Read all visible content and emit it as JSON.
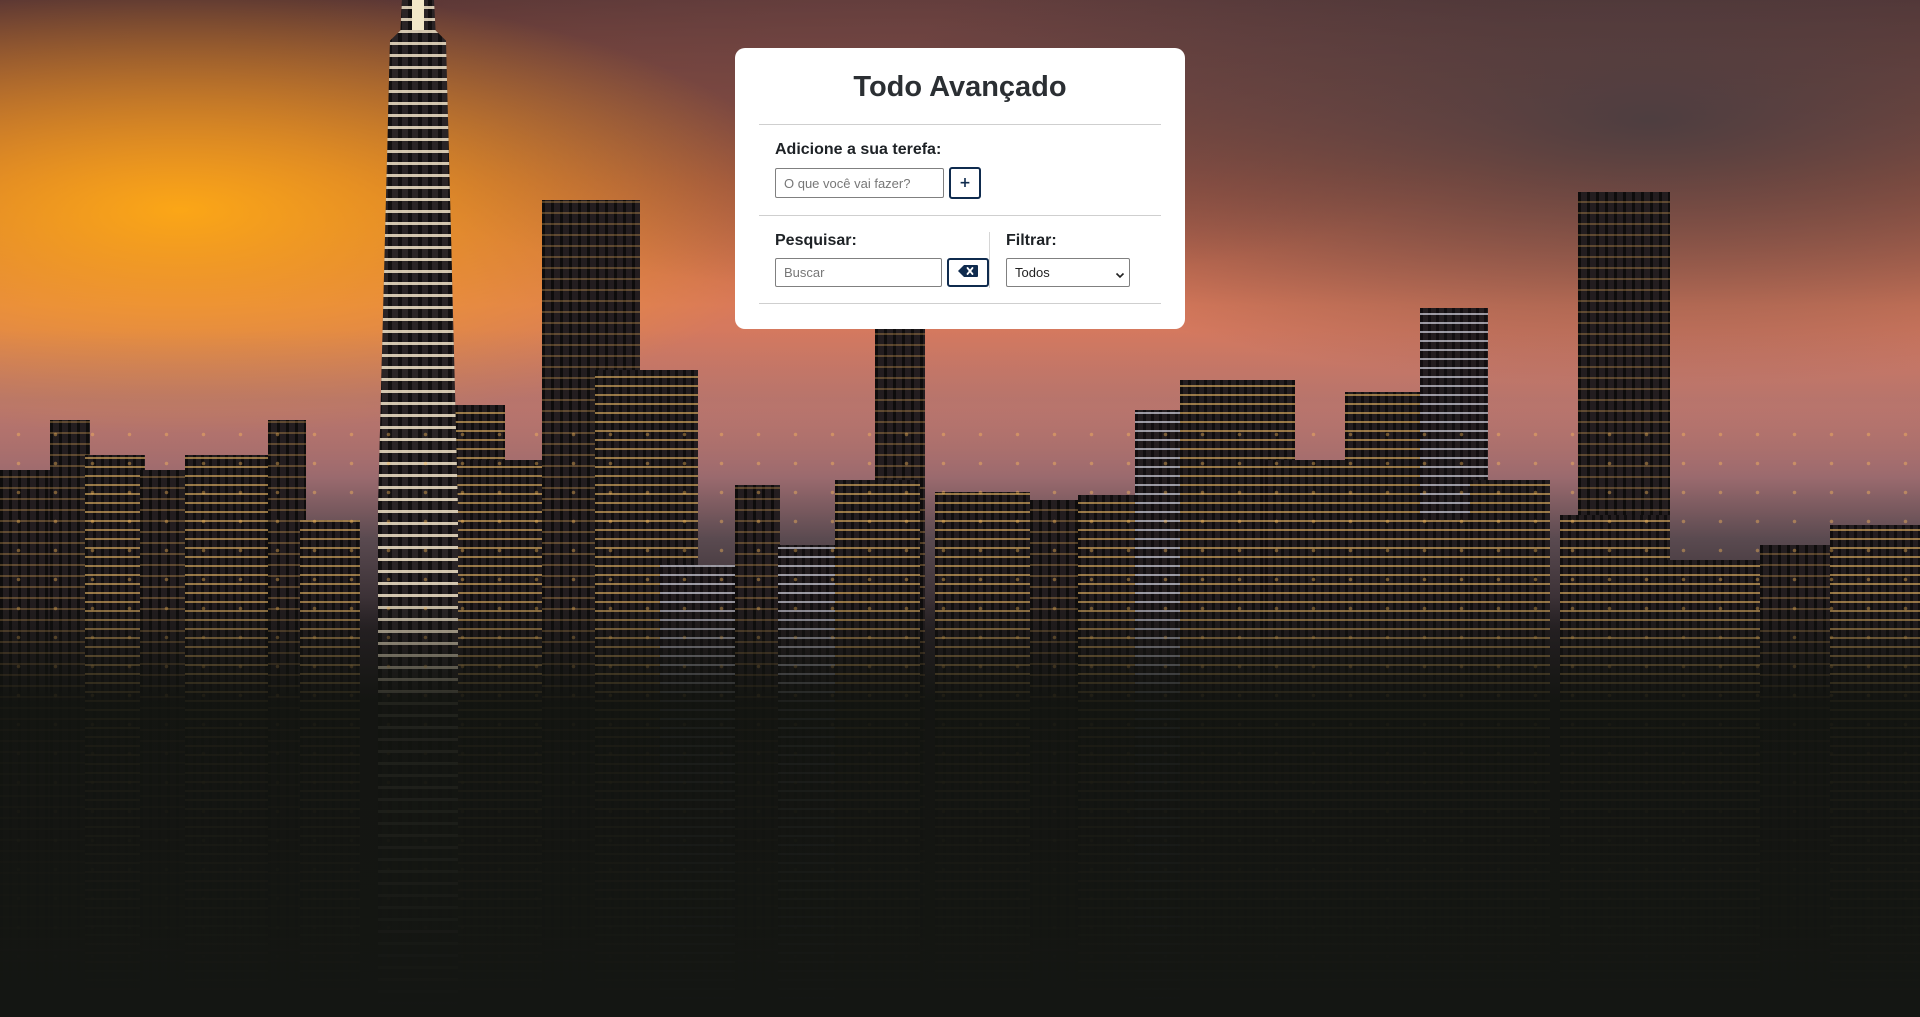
{
  "card": {
    "title": "Todo Avançado",
    "add": {
      "label": "Adicione a sua terefa:",
      "input_placeholder": "O que você vai fazer?",
      "input_value": "",
      "add_button_label": "+"
    },
    "search": {
      "label": "Pesquisar:",
      "input_placeholder": "Buscar",
      "input_value": "",
      "clear_button_icon": "backspace-icon"
    },
    "filter": {
      "label": "Filtrar:",
      "selected": "Todos",
      "dropdown_icon": "chevron-down-icon"
    }
  },
  "background": {
    "description_icon": "city-skyline-photo"
  },
  "colors": {
    "card_background": "#ffffff",
    "title_text": "#2b2f33",
    "button_border": "#0f2b4e",
    "divider": "#cfcfcf"
  }
}
